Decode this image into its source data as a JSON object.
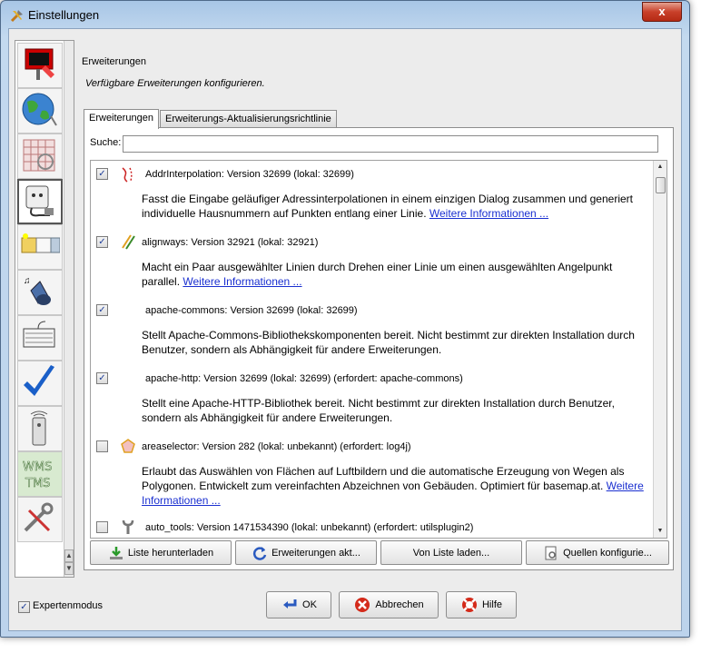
{
  "window": {
    "title": "Einstellungen",
    "close_label": "x"
  },
  "sidebar": {
    "items": [
      {
        "icon": "paint-roller-icon"
      },
      {
        "icon": "globe-icon"
      },
      {
        "icon": "grid-map-icon"
      },
      {
        "icon": "power-plug-icon"
      },
      {
        "icon": "folders-icon"
      },
      {
        "icon": "speaker-icon"
      },
      {
        "icon": "keyboard-icon"
      },
      {
        "icon": "checkmark-icon"
      },
      {
        "icon": "remote-control-icon"
      },
      {
        "icon": "wms-tms-icon",
        "text": "WMS\nTMS"
      },
      {
        "icon": "tools-icon"
      }
    ]
  },
  "header": {
    "title": "Erweiterungen",
    "subtitle": "Verfügbare Erweiterungen konfigurieren."
  },
  "tabs": [
    {
      "label": "Erweiterungen"
    },
    {
      "label": "Erweiterungs-Aktualisierungsrichtlinie"
    }
  ],
  "search": {
    "label": "Suche:",
    "value": ""
  },
  "extensions": [
    {
      "checked": true,
      "icon": "address-interpolation-icon",
      "header": "AddrInterpolation: Version 32699 (lokal: 32699)",
      "description": "Fasst die Eingabe geläufiger Adressinterpolationen in einem einzigen Dialog zusammen und generiert individuelle Hausnummern auf Punkten entlang einer Linie.",
      "link": "Weitere Informationen ..."
    },
    {
      "checked": true,
      "icon": "alignways-icon",
      "header": "alignways: Version 32921 (lokal: 32921)",
      "description": "Macht ein Paar ausgewählter Linien durch Drehen einer Linie um einen ausgewählten Angelpunkt parallel.",
      "link": "Weitere Informationen ..."
    },
    {
      "checked": true,
      "icon": "",
      "header": "apache-commons: Version 32699 (lokal: 32699)",
      "description": "Stellt Apache-Commons-Bibliothekskomponenten bereit. Nicht bestimmt zur direkten Installation durch Benutzer, sondern als Abhängigkeit für andere Erweiterungen.",
      "link": ""
    },
    {
      "checked": true,
      "icon": "",
      "header": "apache-http: Version 32699 (lokal: 32699) (erfordert: apache-commons)",
      "description": "Stellt eine Apache-HTTP-Bibliothek bereit. Nicht bestimmt zur direkten Installation durch Benutzer, sondern als Abhängigkeit für andere Erweiterungen.",
      "link": ""
    },
    {
      "checked": false,
      "icon": "areaselector-icon",
      "header": "areaselector: Version 282 (lokal: unbekannt) (erfordert: log4j)",
      "description": "Erlaubt das Auswählen von Flächen auf Luftbildern und die automatische Erzeugung von Wegen als Polygonen. Entwickelt zum vereinfachten Abzeichnen von Gebäuden. Optimiert für basemap.at.",
      "link": "Weitere Informationen ..."
    },
    {
      "checked": false,
      "icon": "wrench-icon",
      "header": "auto_tools: Version 1471534390 (lokal: unbekannt) (erfordert: utilsplugin2)",
      "description": "",
      "link": ""
    }
  ],
  "list_buttons": [
    {
      "label": "Liste herunterladen",
      "icon": "download-icon"
    },
    {
      "label": "Erweiterungen akt...",
      "icon": "refresh-icon"
    },
    {
      "label": "Von Liste laden...",
      "icon": ""
    },
    {
      "label": "Quellen konfigurie...",
      "icon": "configure-sources-icon"
    }
  ],
  "expert_mode": {
    "label": "Expertenmodus",
    "checked": true
  },
  "dialog_buttons": [
    {
      "label": "OK",
      "icon": "ok-arrow-icon"
    },
    {
      "label": "Abbrechen",
      "icon": "cancel-icon"
    },
    {
      "label": "Hilfe",
      "icon": "help-lifebuoy-icon"
    }
  ],
  "colors": {
    "link": "#1a2fd0",
    "titlebar": "#bcd3ec",
    "close": "#c9402a"
  }
}
